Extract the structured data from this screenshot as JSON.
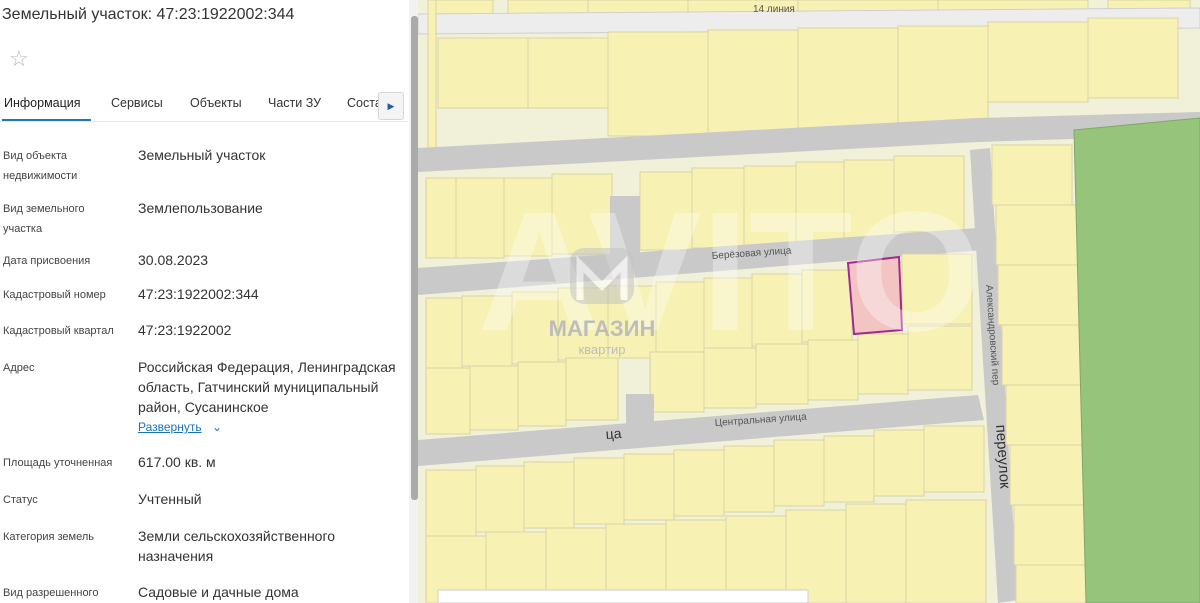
{
  "panel": {
    "title": "Земельный участок: 47:23:1922002:344",
    "favorite_icon": "star-icon",
    "tabs": [
      {
        "label": "Информация",
        "active": true
      },
      {
        "label": "Сервисы"
      },
      {
        "label": "Объекты"
      },
      {
        "label": "Части ЗУ"
      },
      {
        "label": "Соста"
      }
    ],
    "tabs_next_icon": "chevron-right-icon",
    "fields": [
      {
        "label": "Вид объекта недвижимости",
        "value": "Земельный участок"
      },
      {
        "label": "Вид земельного участка",
        "value": "Землепользование"
      },
      {
        "label": "Дата присвоения",
        "value": "30.08.2023"
      },
      {
        "label": "Кадастровый номер",
        "value": "47:23:1922002:344"
      },
      {
        "label": "Кадастровый квартал",
        "value": "47:23:1922002"
      },
      {
        "label": "Адрес",
        "value": "Российская Федерация, Ленинградская область, Гатчинский муниципальный район, Сусанинское"
      },
      {
        "label": "Площадь уточненная",
        "value": "617.00 кв. м"
      },
      {
        "label": "Статус",
        "value": "Учтенный"
      },
      {
        "label": "Категория земель",
        "value": "Земли сельскохозяйственного назначения"
      },
      {
        "label": "Вид разрешенного",
        "value": "Садовые и дачные дома"
      }
    ],
    "expand_label": "Развернуть"
  },
  "map": {
    "streets": {
      "line14": "14 линия",
      "berezovaya": "Берёзовая улица",
      "centralnaya": "Центральная улица",
      "aleksandrovsky": "Александровский пер",
      "pereulok": "переулок",
      "tsa": "ца"
    },
    "watermark": {
      "line1": "МАГАЗИН",
      "line2": "квартир",
      "bg": "AVITO"
    },
    "colors": {
      "parcel_fill": "#f7f2b4",
      "road": "#c9c9c9",
      "green": "#96c47b",
      "selected_stroke": "#a02a90",
      "selected_fill": "#f2c4c4"
    }
  }
}
